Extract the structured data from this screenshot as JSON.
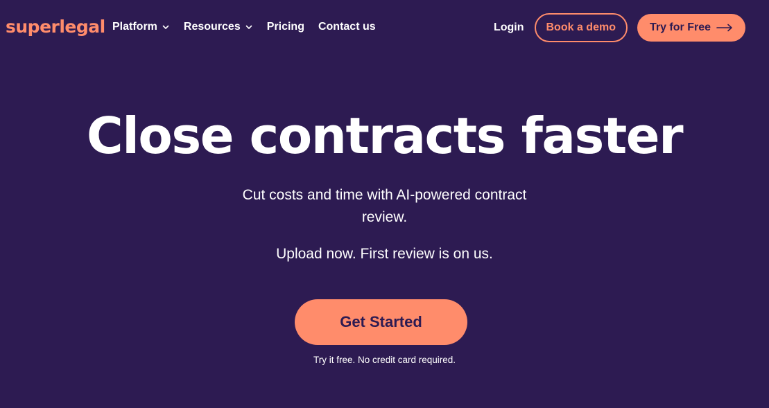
{
  "brand": {
    "logo_text": "superlegal",
    "accent_color": "#ff8c6b",
    "background_color": "#2d1b52"
  },
  "nav": {
    "items": [
      {
        "label": "Platform",
        "icon": "chevron-down-icon"
      },
      {
        "label": "Resources",
        "icon": "chevron-down-icon"
      },
      {
        "label": "Pricing"
      },
      {
        "label": "Contact us"
      }
    ],
    "login_label": "Login",
    "demo_label": "Book a demo",
    "try_label": "Try for Free",
    "try_icon": "arrow-right-icon"
  },
  "hero": {
    "title": "Close contracts faster",
    "subtitle_line1": "Cut costs and time with AI-powered contract",
    "subtitle_line2": "review.",
    "subtitle2": "Upload now. First review is on us.",
    "cta_label": "Get Started",
    "note": "Try it free. No credit card required."
  }
}
